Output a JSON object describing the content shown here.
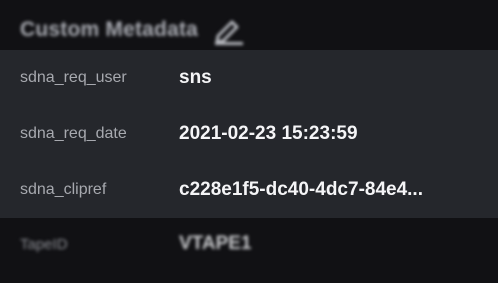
{
  "header": {
    "title": "Custom Metadata",
    "edit_icon": "pencil-edit-icon"
  },
  "metadata": {
    "rows": [
      {
        "key": "sdna_req_user",
        "value": "sns"
      },
      {
        "key": "sdna_req_date",
        "value": "2021-02-23 15:23:59"
      },
      {
        "key": "sdna_clipref",
        "value": "c228e1f5-dc40-4dc7-84e4..."
      }
    ]
  },
  "below": {
    "key": "TapeID",
    "value": "VTAPE1"
  },
  "colors": {
    "background": "#111114",
    "panel": "#25272c",
    "key_text": "#a7a9af",
    "value_text": "#f5f5f7"
  }
}
